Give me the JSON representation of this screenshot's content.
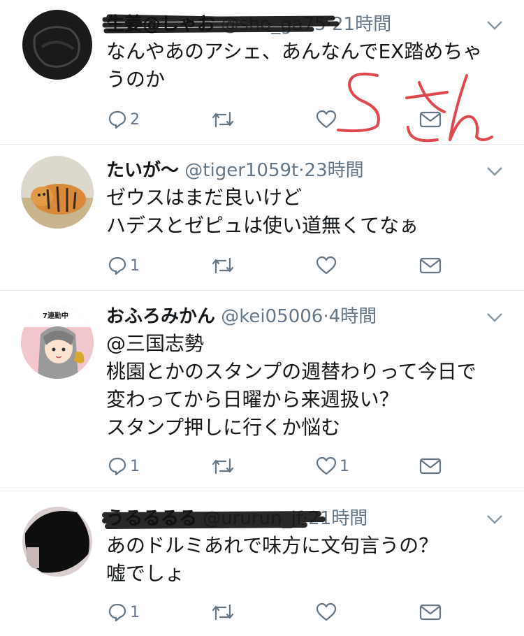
{
  "tweets": [
    {
      "name": "生姜@しゃお",
      "handle": "@sho_ga75",
      "dot": "·",
      "time": "21時間",
      "text": "なんやあのアシェ、あんなんでEX踏めちゃうのか",
      "reply_count": "2",
      "like_count": ""
    },
    {
      "name": "たいが〜",
      "handle": "@tiger1059t",
      "dot": "·",
      "time": "23時間",
      "text": "ゼウスはまだ良いけど\nハデスとゼピュは使い道無くてなぁ",
      "reply_count": "1",
      "like_count": ""
    },
    {
      "name": "おふろみかん",
      "handle": "@kei05006",
      "dot": "·",
      "time": "4時間",
      "text": "@三国志勢\n桃園とかのスタンプの週替わりって今日で変わってから日曜から来週扱い？\nスタンプ押しに行くか悩む",
      "reply_count": "1",
      "like_count": "1",
      "avatar_badge": "7連勤中"
    },
    {
      "name": "うるるるる",
      "handle": "@ururun_jf",
      "dot": "·",
      "time": "21時間",
      "text": "あのドルミあれで味方に文句言うの？\n嘘でしょ",
      "reply_count": "1",
      "like_count": ""
    }
  ],
  "annotation": {
    "text": "Sさん",
    "color": "#e0484f"
  },
  "colors": {
    "icon_gray": "#657786",
    "divider": "#e1e8ed",
    "redaction": "#111111"
  }
}
